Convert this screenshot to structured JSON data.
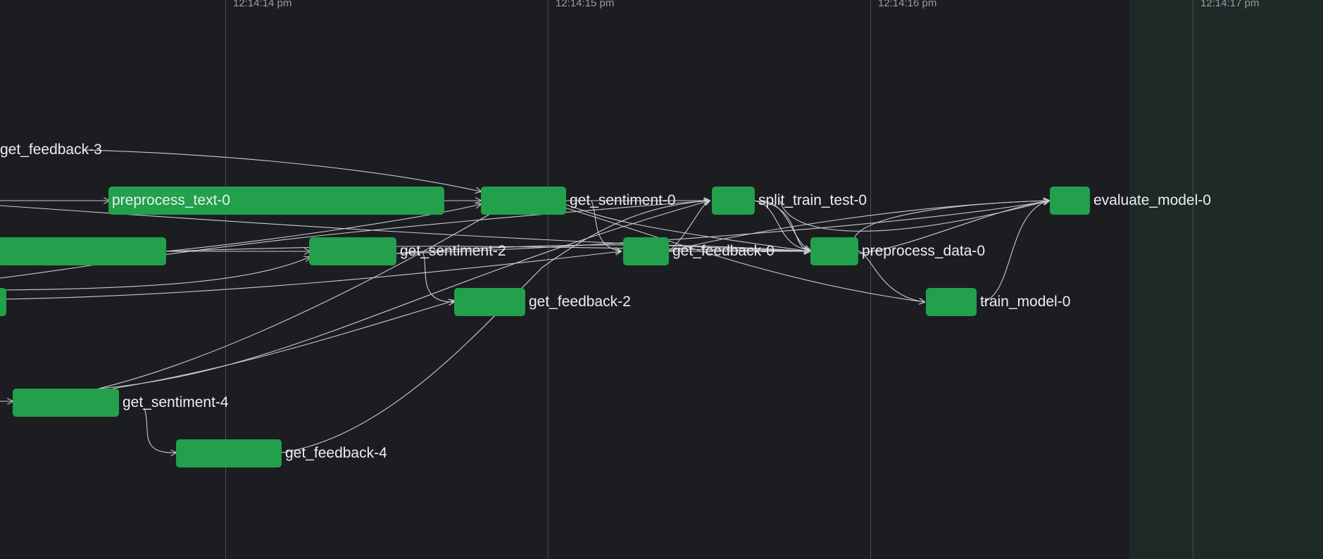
{
  "colors": {
    "background": "#1c1d21",
    "future_zone": "#1d2a27",
    "gridline": "#4a4c52",
    "task_completed": "#22a04b",
    "edge": "#c9cbd0",
    "label": "#eceef1",
    "tick_label": "#9a9ca3"
  },
  "timeline": {
    "ticks": [
      "12:14:14 pm",
      "12:14:15 pm",
      "12:14:16 pm",
      "12:14:17 pm"
    ]
  },
  "tasks": [
    {
      "id": "get-feedback-3",
      "label": "get_feedback-3",
      "state": "completed"
    },
    {
      "id": "preprocess-text-0",
      "label": "preprocess_text-0",
      "state": "completed"
    },
    {
      "id": "get-sentiment-0",
      "label": "get_sentiment-0",
      "state": "completed"
    },
    {
      "id": "split-train-test-0",
      "label": "split_train_test-0",
      "state": "completed"
    },
    {
      "id": "evaluate-model-0",
      "label": "evaluate_model-0",
      "state": "completed"
    },
    {
      "id": "task-row3-left",
      "label": "",
      "state": "completed"
    },
    {
      "id": "get-sentiment-2",
      "label": "get_sentiment-2",
      "state": "completed"
    },
    {
      "id": "get-feedback-0",
      "label": "get_feedback-0",
      "state": "completed"
    },
    {
      "id": "preprocess-data-0",
      "label": "preprocess_data-0",
      "state": "completed"
    },
    {
      "id": "task-row4-left",
      "label": "",
      "state": "completed"
    },
    {
      "id": "get-feedback-2",
      "label": "get_feedback-2",
      "state": "completed"
    },
    {
      "id": "train-model-0",
      "label": "train_model-0",
      "state": "completed"
    },
    {
      "id": "get-sentiment-4",
      "label": "get_sentiment-4",
      "state": "completed"
    },
    {
      "id": "get-feedback-4",
      "label": "get_feedback-4",
      "state": "completed"
    }
  ]
}
